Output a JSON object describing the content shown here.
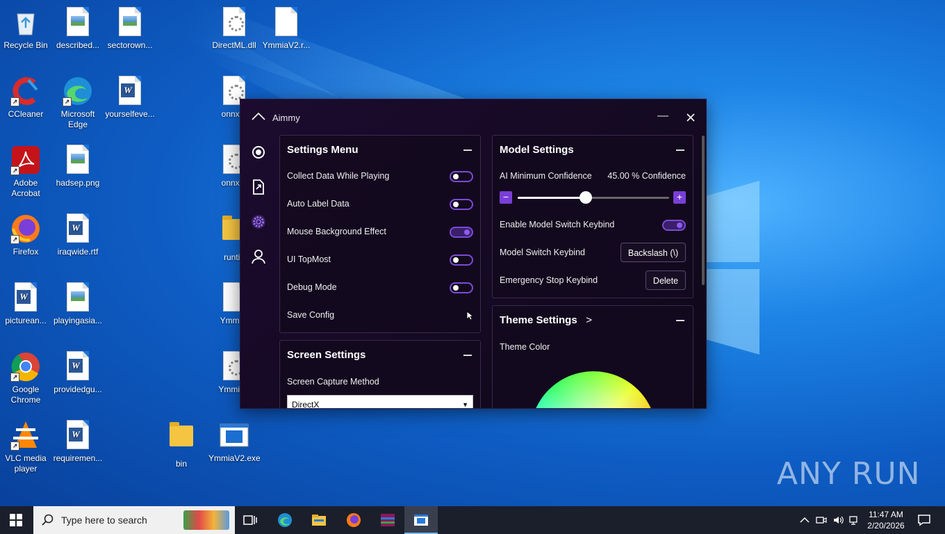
{
  "desktop": {
    "icons": [
      {
        "label": "Recycle Bin",
        "icon": "recycle-bin-icon"
      },
      {
        "label": "described...",
        "icon": "image-file-icon"
      },
      {
        "label": "sectorown...",
        "icon": "image-file-icon"
      },
      {
        "label": "DirectML.dll",
        "icon": "dll-file-icon"
      },
      {
        "label": "YmmiaV2.r...",
        "icon": "blank-file-icon"
      },
      {
        "label": "CCleaner",
        "icon": "ccleaner-icon"
      },
      {
        "label": "Microsoft Edge",
        "icon": "edge-icon"
      },
      {
        "label": "yourselfeve...",
        "icon": "word-file-icon"
      },
      {
        "label": "onnxru",
        "icon": "dll-file-icon"
      },
      {
        "label": "Adobe Acrobat",
        "icon": "acrobat-icon"
      },
      {
        "label": "hadsep.png",
        "icon": "image-file-icon"
      },
      {
        "label": "onnxru",
        "icon": "dll-file-icon"
      },
      {
        "label": "Firefox",
        "icon": "firefox-icon"
      },
      {
        "label": "iraqwide.rtf",
        "icon": "word-file-icon"
      },
      {
        "label": "runtin",
        "icon": "folder-icon"
      },
      {
        "label": "picturean...",
        "icon": "word-file-icon"
      },
      {
        "label": "playingasia...",
        "icon": "image-file-icon"
      },
      {
        "label": "Ymmia\\",
        "icon": "blank-file-icon"
      },
      {
        "label": "Google Chrome",
        "icon": "chrome-icon"
      },
      {
        "label": "providedgu...",
        "icon": "word-file-icon"
      },
      {
        "label": "YmmiaV",
        "icon": "dll-file-icon"
      },
      {
        "label": "VLC media player",
        "icon": "vlc-icon"
      },
      {
        "label": "requiremen...",
        "icon": "word-file-icon"
      },
      {
        "label": "bin",
        "icon": "folder-icon"
      },
      {
        "label": "YmmiaV2.exe",
        "icon": "exe-file-icon"
      }
    ]
  },
  "app": {
    "title": "Aimmy",
    "sidebar": [
      "aim-icon",
      "file-export-icon",
      "settings-gear-icon",
      "user-icon"
    ],
    "settings_menu": {
      "title": "Settings Menu",
      "rows": [
        {
          "label": "Collect Data While Playing",
          "on": false
        },
        {
          "label": "Auto Label Data",
          "on": false
        },
        {
          "label": "Mouse Background Effect",
          "on": true
        },
        {
          "label": "UI TopMost",
          "on": false
        },
        {
          "label": "Debug Mode",
          "on": false
        }
      ],
      "save_label": "Save Config"
    },
    "screen_settings": {
      "title": "Screen Settings",
      "capture_label": "Screen Capture Method",
      "capture_value": "DirectX"
    },
    "model_settings": {
      "title": "Model Settings",
      "confidence_label": "AI Minimum Confidence",
      "confidence_value": "45.00 % Confidence",
      "confidence_fraction": 0.45,
      "minus": "−",
      "plus": "+",
      "switch_label": "Enable Model Switch Keybind",
      "switch_on": true,
      "keybind_label": "Model Switch Keybind",
      "keybind_value": "Backslash (\\)",
      "stop_label": "Emergency Stop Keybind",
      "stop_value": "Delete"
    },
    "theme_settings": {
      "title": "Theme Settings",
      "arrow": ">",
      "color_label": "Theme Color"
    }
  },
  "taskbar": {
    "search_placeholder": "Type here to search",
    "time": "11:47 AM",
    "date": "2/20/2026"
  },
  "watermark": "ANY RUN"
}
